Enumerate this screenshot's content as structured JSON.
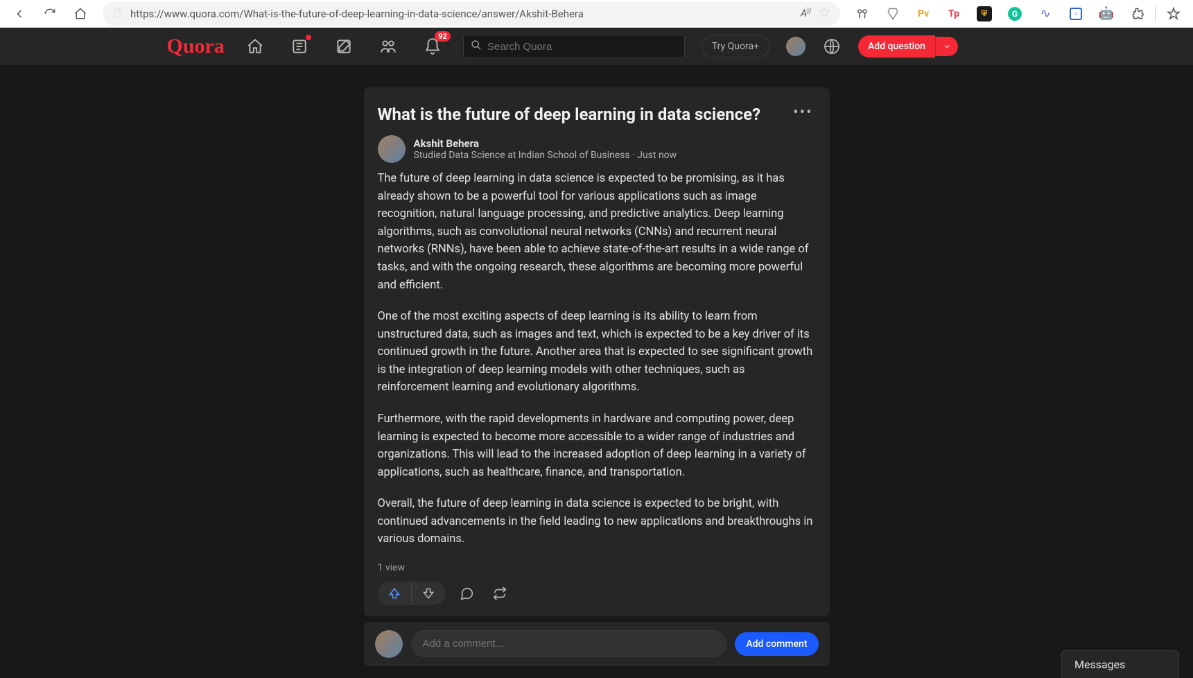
{
  "browser": {
    "url": "https://www.quora.com/What-is-the-future-of-deep-learning-in-data-science/answer/Akshit-Behera"
  },
  "header": {
    "logo": "Quora",
    "notification_count": "92",
    "search_placeholder": "Search Quora",
    "try_label": "Try Quora+",
    "add_question_label": "Add question"
  },
  "answer": {
    "question_title": "What is the future of deep learning in data science?",
    "author_name": "Akshit Behera",
    "author_cred": "Studied Data Science at Indian School of Business · Just now",
    "paragraphs": [
      "The future of deep learning in data science is expected to be promising, as it has already shown to be a powerful tool for various applications such as image recognition, natural language processing, and predictive analytics. Deep learning algorithms, such as convolutional neural networks (CNNs) and recurrent neural networks (RNNs), have been able to achieve state-of-the-art results in a wide range of tasks, and with the ongoing research, these algorithms are becoming more powerful and efficient.",
      "One of the most exciting aspects of deep learning is its ability to learn from unstructured data, such as images and text, which is expected to be a key driver of its continued growth in the future. Another area that is expected to see significant growth is the integration of deep learning models with other techniques, such as reinforcement learning and evolutionary algorithms.",
      "Furthermore, with the rapid developments in hardware and computing power, deep learning is expected to become more accessible to a wider range of industries and organizations. This will lead to the increased adoption of deep learning in a variety of applications, such as healthcare, finance, and transportation.",
      "Overall, the future of deep learning in data science is expected to be bright, with continued advancements in the field leading to new applications and breakthroughs in various domains."
    ],
    "views": "1 view"
  },
  "comment": {
    "placeholder": "Add a comment...",
    "button": "Add comment"
  },
  "messages_tab": "Messages"
}
